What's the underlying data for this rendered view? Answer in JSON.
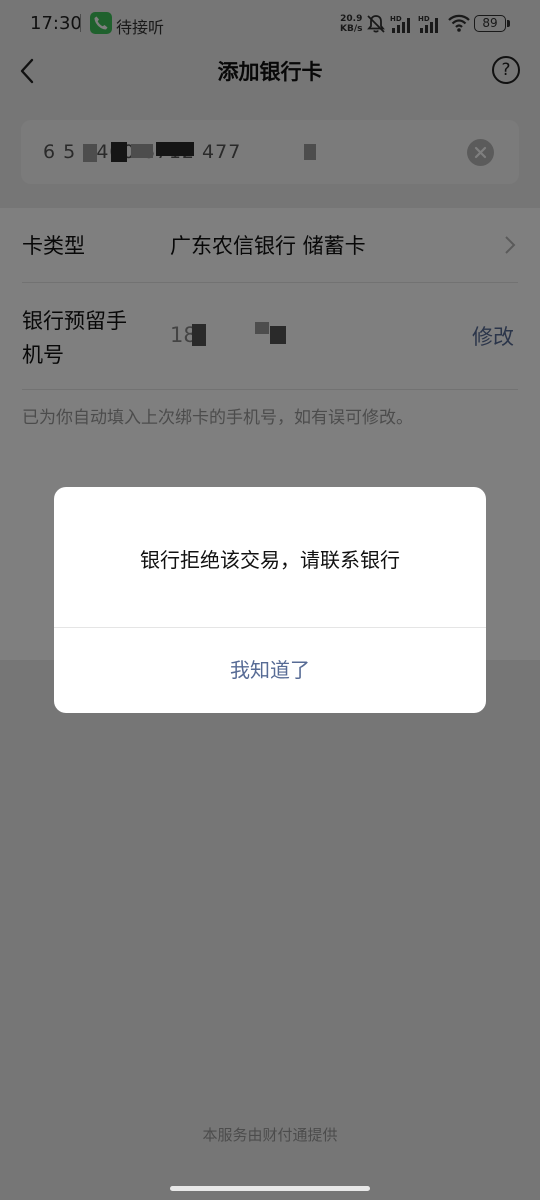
{
  "status_bar": {
    "time": "17:30",
    "call_label": "待接听",
    "net_speed_value": "20.9",
    "net_speed_unit": "KB/s",
    "battery": "89",
    "signal_badge": "HD"
  },
  "nav": {
    "title": "添加银行卡",
    "help_symbol": "?"
  },
  "card": {
    "number_masked": "6    5    3400 6712 477",
    "clear_icon": "clear-icon"
  },
  "form": {
    "card_type_label": "卡类型",
    "card_type_value": "广东农信银行 储蓄卡",
    "phone_label_line1": "银行预留手",
    "phone_label_line2": "机号",
    "phone_value_masked": "18",
    "modify_label": "修改",
    "hint": "已为你自动填入上次绑卡的手机号，如有误可修改。"
  },
  "dialog": {
    "message": "银行拒绝该交易，请联系银行",
    "button_label": "我知道了"
  },
  "footer": {
    "note": "本服务由财付通提供"
  },
  "colors": {
    "accent_link": "#576b95",
    "call_green": "#3fc25a",
    "overlay": "rgba(0,0,0,0.5)"
  }
}
